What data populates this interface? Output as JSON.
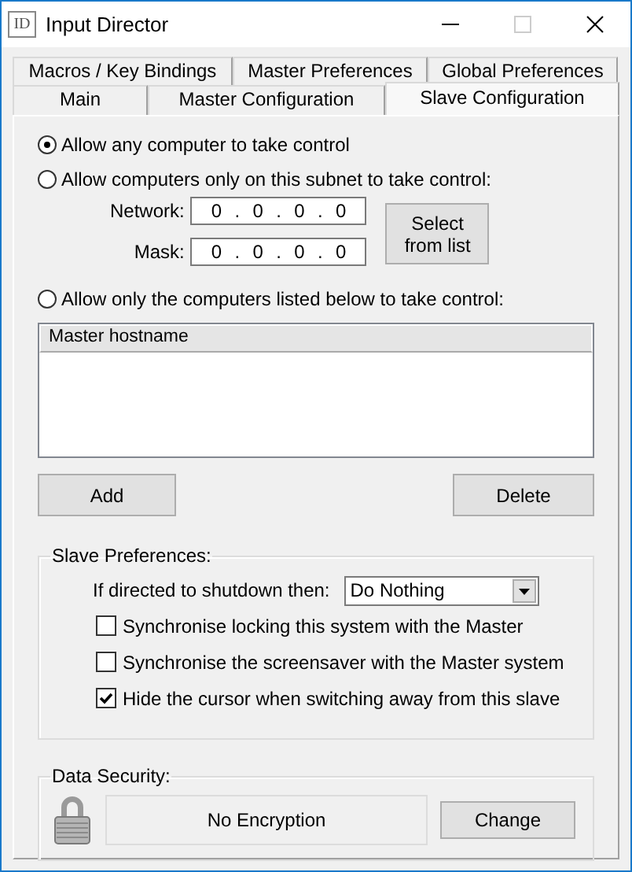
{
  "window": {
    "title": "Input Director",
    "icon_text": "ID"
  },
  "tab_rows": [
    [
      {
        "label": "Macros / Key Bindings",
        "selected": false
      },
      {
        "label": "Master Preferences",
        "selected": false
      },
      {
        "label": "Global Preferences",
        "selected": false
      }
    ],
    [
      {
        "label": "Main",
        "selected": false
      },
      {
        "label": "Master Configuration",
        "selected": false
      },
      {
        "label": "Slave Configuration",
        "selected": true
      }
    ]
  ],
  "access_options": [
    {
      "label": "Allow any computer to take control",
      "selected": true
    },
    {
      "label": "Allow computers only on this subnet to take control:",
      "selected": false
    },
    {
      "label": "Allow only the computers listed below to take control:",
      "selected": false
    }
  ],
  "subnet_fields": [
    {
      "label": "Network:",
      "octets": [
        "0",
        "0",
        "0",
        "0"
      ],
      "separator": "."
    },
    {
      "label": "Mask:",
      "octets": [
        "0",
        "0",
        "0",
        "0"
      ],
      "separator": "."
    }
  ],
  "select_button": "Select from list",
  "master_list": {
    "columns": [
      "Master hostname"
    ]
  },
  "add_button": "Add",
  "delete_button": "Delete",
  "slave_preferences": {
    "title": "Slave Preferences:",
    "shutdown_label": "If directed to shutdown then:",
    "shutdown_value": "Do Nothing",
    "checkboxes": [
      {
        "label": "Synchronise locking this system with the Master",
        "checked": false
      },
      {
        "label": "Synchronise the screensaver with the Master system",
        "checked": false
      },
      {
        "label": "Hide the cursor when switching away from this slave",
        "checked": true
      }
    ]
  },
  "data_security": {
    "title": "Data Security:",
    "status": "No Encryption",
    "button": "Change"
  }
}
